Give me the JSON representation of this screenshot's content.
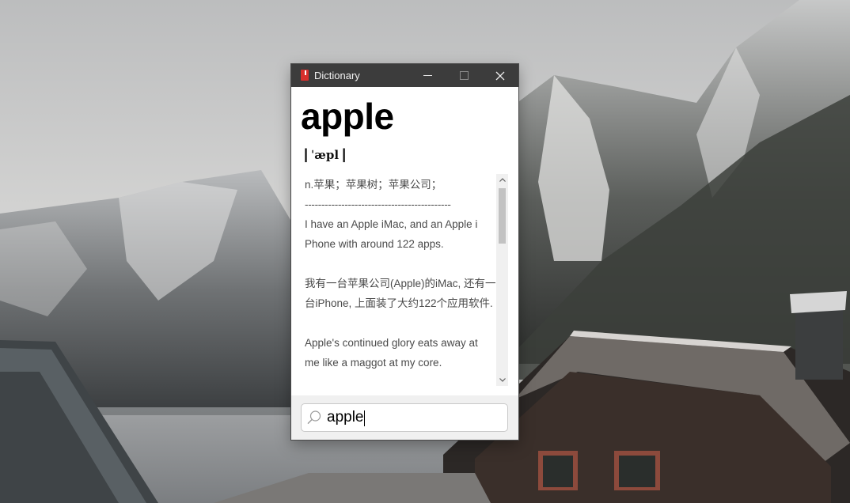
{
  "window": {
    "title": "Dictionary",
    "icon": "dictionary-book-icon",
    "controls": [
      "minimize-icon",
      "maximize-icon",
      "close-icon"
    ]
  },
  "entry": {
    "word": "apple",
    "phonetic_bar_left": "|",
    "phonetic": "ˈæpl",
    "phonetic_bar_right": "|"
  },
  "definition": {
    "pos_meaning": "n.苹果；苹果树；苹果公司；",
    "divider": "--------------------------------------------",
    "example1_en_line1": "I have an Apple iMac, and an Apple i",
    "example1_en_line2": "Phone with around 122 apps.",
    "example1_zh_line1": "我有一台苹果公司(Apple)的iMac, 还有一",
    "example1_zh_line2": "台iPhone, 上面装了大约122个应用软件.",
    "example2_en_line1": "Apple's continued glory eats away at",
    "example2_en_line2": "me like a maggot at my core."
  },
  "search": {
    "value": "apple",
    "icon": "search-icon"
  },
  "colors": {
    "titlebar": "#3c3c3c",
    "icon_red": "#d8302c",
    "footer_bg": "#f0f0f0",
    "body_text": "#4a4a4a"
  }
}
